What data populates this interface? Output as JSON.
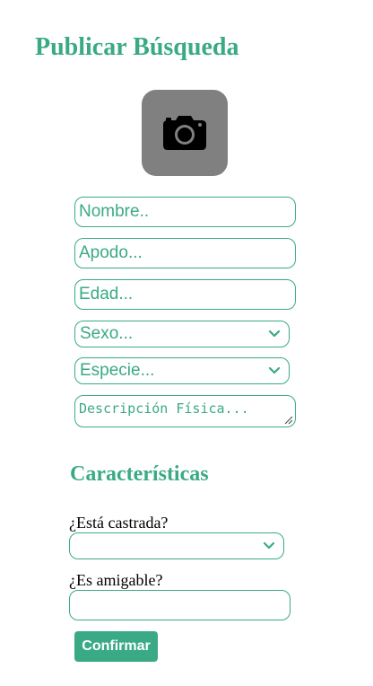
{
  "page": {
    "title": "Publicar Búsqueda"
  },
  "photo": {
    "icon": "camera-icon"
  },
  "form": {
    "nombre_placeholder": "Nombre..",
    "apodo_placeholder": "Apodo...",
    "edad_placeholder": "Edad...",
    "sexo_selected": "Sexo...",
    "especie_selected": "Especie...",
    "descripcion_placeholder": "Descripción Física..."
  },
  "caracteristicas": {
    "title": "Características",
    "castrada_label": "¿Está castrada?",
    "castrada_selected": "",
    "amigable_label": "¿Es amigable?",
    "amigable_value": ""
  },
  "actions": {
    "confirm_label": "Confirmar"
  },
  "colors": {
    "accent": "#3aaa86",
    "photo_bg": "#808080"
  }
}
